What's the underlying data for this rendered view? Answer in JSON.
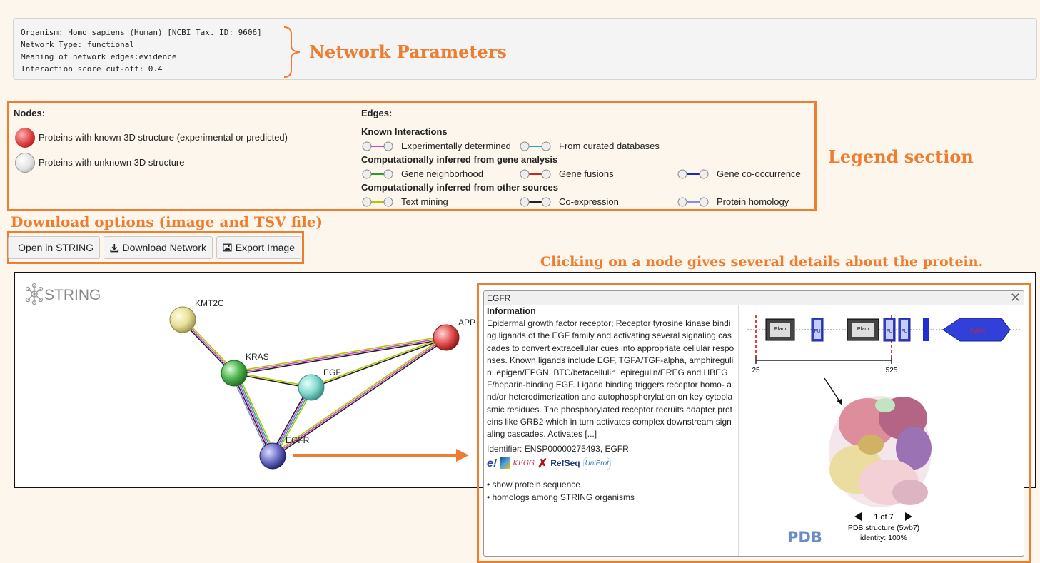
{
  "params": {
    "lines": [
      "Organism: Homo sapiens (Human) [NCBI Tax. ID: 9606]",
      "Network Type: functional",
      "Meaning of network edges:evidence",
      "Interaction score cut-off: 0.4"
    ]
  },
  "annotations": {
    "network_parameters": "Network Parameters",
    "legend_section": "Legend section",
    "download_options": "Download options (image and TSV file)",
    "click_node": "Clicking on a node gives several details about the protein."
  },
  "legend": {
    "nodes_title": "Nodes:",
    "edges_title": "Edges:",
    "nodes": [
      "Proteins with known 3D structure (experimental or predicted)",
      "Proteins with unknown 3D structure"
    ],
    "known_title": "Known Interactions",
    "gene_title": "Computationally inferred from gene analysis",
    "other_title": "Computationally inferred from other sources",
    "edges": {
      "experimental": {
        "label": "Experimentally determined",
        "color": "#c545c5"
      },
      "curated": {
        "label": "From curated databases",
        "color": "#1fa5c0"
      },
      "neighborhood": {
        "label": "Gene neighborhood",
        "color": "#2d9a2d"
      },
      "fusions": {
        "label": "Gene fusions",
        "color": "#c62828"
      },
      "cooccurrence": {
        "label": "Gene co-occurrence",
        "color": "#1c2bb5"
      },
      "textmining": {
        "label": "Text mining",
        "color": "#b5c500"
      },
      "coexpression": {
        "label": "Co-expression",
        "color": "#222222"
      },
      "homology": {
        "label": "Protein homology",
        "color": "#8a8ae6"
      }
    }
  },
  "buttons": {
    "open_string": "Open in STRING",
    "download_network": "Download Network",
    "export_image": "Export Image"
  },
  "network": {
    "logo": "STRING",
    "nodes": {
      "kmt2c": "KMT2C",
      "kras": "KRAS",
      "egf": "EGF",
      "egfr": "EGFR",
      "app": "APP"
    }
  },
  "popup": {
    "title": "EGFR",
    "info_title": "Information",
    "description": "Epidermal growth factor receptor; Receptor tyrosine kinase binding ligands of the EGF family and activating several signaling cascades to convert extracellular cues into appropriate cellular responses. Known ligands include EGF, TGFA/TGF-alpha, amphiregulin, epigen/EPGN, BTC/betacellulin, epiregulin/EREG and HBEGF/heparin-binding EGF. Ligand binding triggers receptor homo- and/or heterodimerization and autophosphorylation on key cytoplasmic residues. The phosphorylated receptor recruits adapter proteins like GRB2 which in turn activates complex downstream signaling cascades. Activates [...]",
    "identifier": "Identifier: ENSP00000275493, EGFR",
    "links": [
      "• show protein sequence",
      "• homologs among STRING organisms"
    ],
    "db_icons": {
      "ensembl": "e!",
      "kegg": "KEGG",
      "refseq": "RefSeq",
      "uniprot": "UniProt"
    },
    "domains": {
      "pfam1": "Pfam",
      "pfam2": "Pfam",
      "fu1": "FU",
      "fu2": "FU",
      "fu3": "FU",
      "tyrkc": "TyrKc"
    },
    "range_start": "25",
    "range_end": "525",
    "pager": "1 of 7",
    "structure_label": "PDB structure (5wb7)",
    "identity": "identity: 100%",
    "pdb_logo": "PDB"
  }
}
